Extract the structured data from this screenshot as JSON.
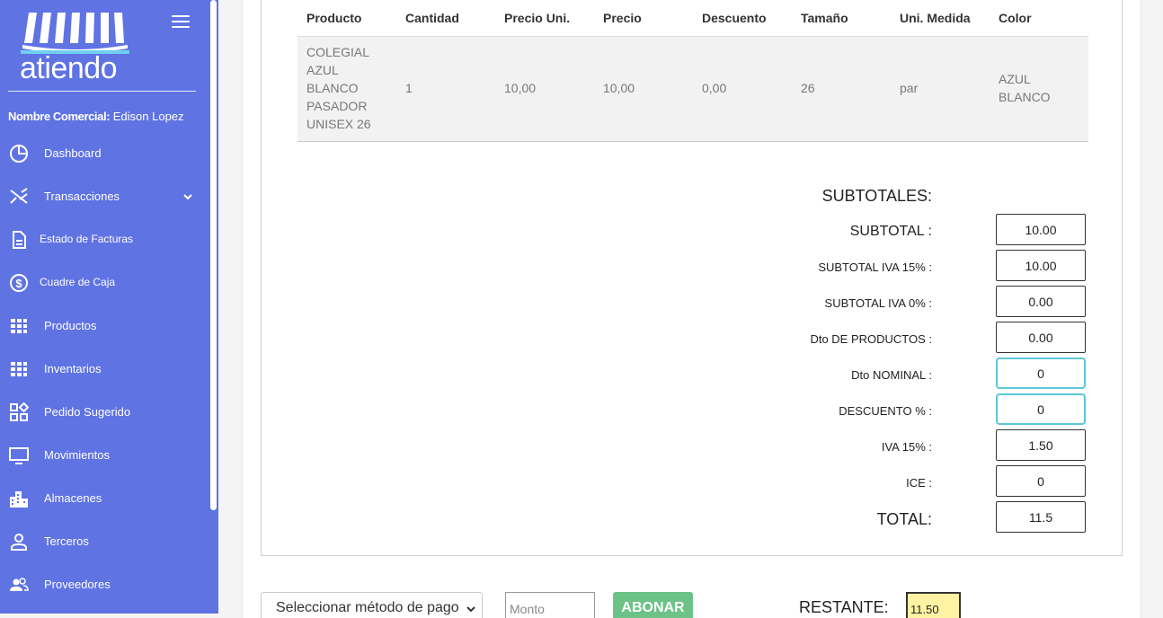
{
  "sidebar": {
    "logo_text": "atiendo",
    "merchant_label": "Nombre Comercial:",
    "merchant_name": "Edison Lopez",
    "items": [
      {
        "label": "Dashboard",
        "icon": "pie-chart-icon"
      },
      {
        "label": "Transacciones",
        "icon": "transactions-icon"
      },
      {
        "label": "Estado de Facturas",
        "icon": "document-icon"
      },
      {
        "label": "Cuadre de Caja",
        "icon": "dollar-circle-icon"
      },
      {
        "label": "Productos",
        "icon": "grid-icon"
      },
      {
        "label": "Inventarios",
        "icon": "grid-icon"
      },
      {
        "label": "Pedido Sugerido",
        "icon": "widgets-icon"
      },
      {
        "label": "Movimientos",
        "icon": "monitor-icon"
      },
      {
        "label": "Almacenes",
        "icon": "buildings-icon"
      },
      {
        "label": "Terceros",
        "icon": "person-icon"
      },
      {
        "label": "Proveedores",
        "icon": "people-icon"
      }
    ]
  },
  "table": {
    "headers": [
      "Producto",
      "Cantidad",
      "Precio Uni.",
      "Precio",
      "Descuento",
      "Tamaño",
      "Uni. Medida",
      "Color"
    ],
    "row": {
      "producto_lines": [
        "COLEGIAL",
        "AZUL",
        "BLANCO",
        "PASADOR",
        "UNISEX 26"
      ],
      "cantidad": "1",
      "precio_uni": "10,00",
      "precio": "10,00",
      "descuento": "0,00",
      "tamano": "26",
      "uni_medida": "par",
      "color_lines": [
        "AZUL",
        "BLANCO"
      ]
    }
  },
  "subtotals": {
    "title": "SUBTOTALES:",
    "subtotal_label": "SUBTOTAL :",
    "subtotal_value": "10.00",
    "iva15_label": "SUBTOTAL IVA 15% :",
    "iva15_value": "10.00",
    "iva0_label": "SUBTOTAL IVA 0% :",
    "iva0_value": "0.00",
    "dto_prod_label": "Dto DE PRODUCTOS :",
    "dto_prod_value": "0.00",
    "dto_nom_label": "Dto NOMINAL :",
    "dto_nom_value": "0",
    "desc_pct_label": "DESCUENTO % :",
    "desc_pct_value": "0",
    "iva_label": "IVA 15% :",
    "iva_value": "1.50",
    "ice_label": "ICE :",
    "ice_value": "0",
    "total_label": "TOTAL:",
    "total_value": "11.5"
  },
  "payment": {
    "method_placeholder": "Seleccionar método de pago",
    "monto_placeholder": "Monto",
    "abonar_label": "ABONAR",
    "restante_label": "RESTANTE:",
    "restante_value": "11.50"
  }
}
